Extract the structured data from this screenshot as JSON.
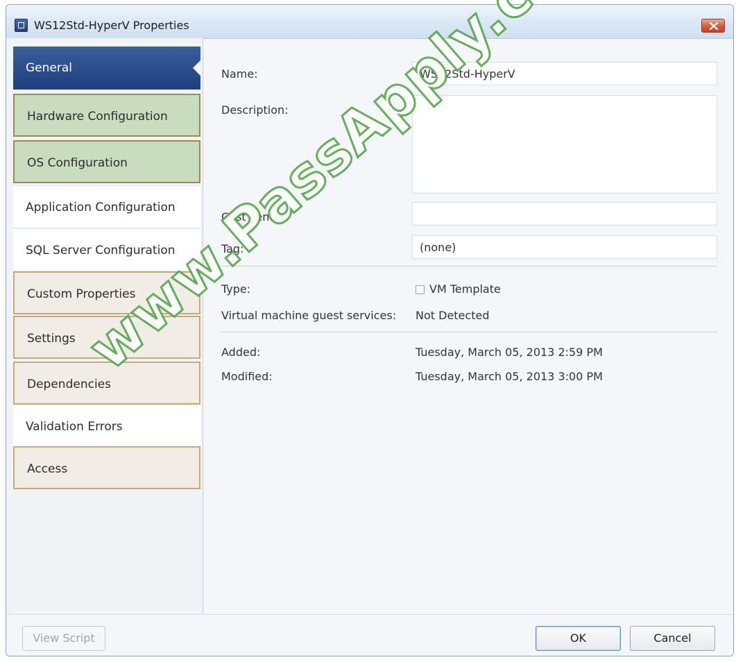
{
  "window": {
    "title": "WS12Std-HyperV Properties"
  },
  "sidebar": {
    "items": [
      {
        "label": "General"
      },
      {
        "label": "Hardware Configuration"
      },
      {
        "label": "OS Configuration"
      },
      {
        "label": "Application Configuration"
      },
      {
        "label": "SQL Server Configuration"
      },
      {
        "label": "Custom Properties"
      },
      {
        "label": "Settings"
      },
      {
        "label": "Dependencies"
      },
      {
        "label": "Validation Errors"
      },
      {
        "label": "Access"
      }
    ]
  },
  "general": {
    "name_label": "Name:",
    "name_value": "WS12Std-HyperV",
    "description_label": "Description:",
    "description_value": "",
    "cost_center_label": "Cost center:",
    "cost_center_value": "",
    "tag_label": "Tag:",
    "tag_value": "(none)",
    "type_label": "Type:",
    "type_value": "VM Template",
    "guest_services_label": "Virtual machine guest services:",
    "guest_services_value": "Not Detected",
    "added_label": "Added:",
    "added_value": "Tuesday, March 05, 2013 2:59 PM",
    "modified_label": "Modified:",
    "modified_value": "Tuesday, March 05, 2013 3:00 PM"
  },
  "footer": {
    "view_script_label": "View Script",
    "ok_label": "OK",
    "cancel_label": "Cancel"
  },
  "watermark": {
    "text": "www.PassApply.com"
  },
  "colors": {
    "active_nav": "#2a4b8d",
    "highlight_green": "#cadcc0",
    "highlight_tan_border": "#c7a97d",
    "watermark_outline": "#58a850"
  }
}
